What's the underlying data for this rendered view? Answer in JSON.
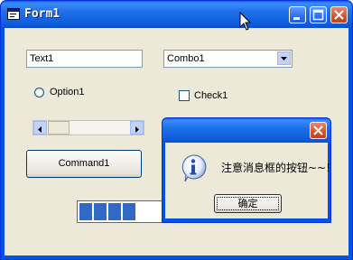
{
  "window": {
    "title": "Form1",
    "controls": [
      "minimize",
      "maximize",
      "close"
    ]
  },
  "form": {
    "text1_value": "Text1",
    "combo1_value": "Combo1",
    "option1_label": "Option1",
    "check1_label": "Check1",
    "command1_label": "Command1",
    "progress_filled_blocks": 4
  },
  "messagebox": {
    "title": "",
    "icon": "info-icon",
    "message": "注意消息框的按钮~~!",
    "ok_label": "确定"
  },
  "colors": {
    "titlebar": "#0d5bdc",
    "client": "#ece9d8",
    "close_button": "#d2532e",
    "progress": "#3169c6"
  }
}
